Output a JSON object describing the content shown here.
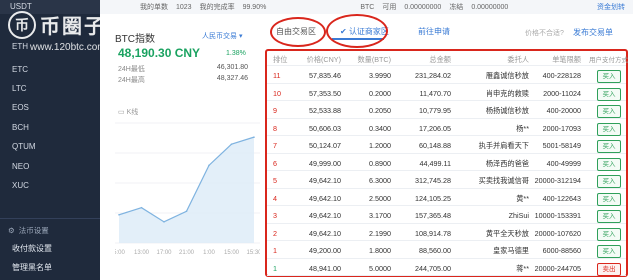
{
  "topbar": {
    "partial_left": "USDT",
    "pending_label": "我的单数",
    "pending_value": "1023",
    "rate_label": "我的完成率",
    "rate_value": "99.90%",
    "coin": "BTC",
    "available_label": "可用",
    "available_value": "0.00000000",
    "frozen_label": "冻结",
    "frozen_value": "0.00000000",
    "right_link": "资金划转"
  },
  "watermark": {
    "brand": "币圈子",
    "url": "www.120btc.com"
  },
  "sidebar": {
    "coins": [
      "ETH",
      "ETC",
      "LTC",
      "EOS",
      "BCH",
      "QTUM",
      "NEO",
      "XUC"
    ],
    "settings_label": "法币设置",
    "links": [
      "收付款设置",
      "管理黑名单"
    ]
  },
  "market": {
    "pair": "BTC指数",
    "market_select": "人民币交易",
    "price": "48,190.30 CNY",
    "change": "1.38%",
    "high_label": "24H最低",
    "high_value": "46,301.80",
    "low_label": "24H最高",
    "low_value": "48,327.46",
    "chart_label": "K线",
    "times": [
      "5:00",
      "13:00",
      "17:00",
      "21:00",
      "1:00",
      "15:00",
      "15:30"
    ]
  },
  "tabs": {
    "free": "自由交易区",
    "cert": "认证商家区",
    "apply": "前往申请",
    "hint": "价格不合适?",
    "post": "发布交易单"
  },
  "table": {
    "headers": {
      "rank": "排位",
      "price": "价格(CNY)",
      "qty": "数量(BTC)",
      "total": "总金额",
      "merchant": "委托人",
      "limit": "单笔限额",
      "action": "用户支付方式"
    },
    "rows": [
      {
        "rank": "11",
        "price": "57,835.46",
        "qty": "3.9990",
        "total": "231,284.02",
        "merchant": "雁鑫诚信秒放",
        "limit": "400-228128",
        "action": "买入"
      },
      {
        "rank": "10",
        "price": "57,353.50",
        "qty": "0.2000",
        "total": "11,470.70",
        "merchant": "肖申克的救赎",
        "limit": "2000-11024",
        "action": "买入"
      },
      {
        "rank": "9",
        "price": "52,533.88",
        "qty": "0.2050",
        "total": "10,779.95",
        "merchant": "杨扬诚信秒放",
        "limit": "400-20000",
        "action": "买入"
      },
      {
        "rank": "8",
        "price": "50,606.03",
        "qty": "0.3400",
        "total": "17,206.05",
        "merchant": "杨**",
        "limit": "2000-17093",
        "action": "买入"
      },
      {
        "rank": "7",
        "price": "50,124.07",
        "qty": "1.2000",
        "total": "60,148.88",
        "merchant": "执手并肩看天下",
        "limit": "5001-58149",
        "action": "买入"
      },
      {
        "rank": "6",
        "price": "49,999.00",
        "qty": "0.8900",
        "total": "44,499.11",
        "merchant": "杨泽西的爸爸",
        "limit": "400-49999",
        "action": "买入"
      },
      {
        "rank": "5",
        "price": "49,642.10",
        "qty": "6.3000",
        "total": "312,745.28",
        "merchant": "买卖找我诚信哥",
        "limit": "20000-312194",
        "action": "买入"
      },
      {
        "rank": "4",
        "price": "49,642.10",
        "qty": "2.5000",
        "total": "124,105.25",
        "merchant": "黄**",
        "limit": "400-122643",
        "action": "买入"
      },
      {
        "rank": "3",
        "price": "49,642.10",
        "qty": "3.1700",
        "total": "157,365.48",
        "merchant": "ZhiSui",
        "limit": "10000-153391",
        "action": "买入"
      },
      {
        "rank": "2",
        "price": "49,642.10",
        "qty": "2.1990",
        "total": "108,914.78",
        "merchant": "黄平全天秒放",
        "limit": "20000-107620",
        "action": "买入"
      },
      {
        "rank": "1",
        "price": "49,200.00",
        "qty": "1.8000",
        "total": "88,560.00",
        "merchant": "皇家马德里",
        "limit": "6000-88560",
        "action": "买入"
      },
      {
        "rank": "1",
        "price": "48,941.00",
        "qty": "5.0000",
        "total": "244,705.00",
        "merchant": "蒋**",
        "limit": "20000-244705",
        "action": "卖出"
      }
    ]
  },
  "chart_data": {
    "type": "line",
    "x": [
      "5:00",
      "13:00",
      "17:00",
      "21:00",
      "1:00",
      "15:00",
      "15:30"
    ],
    "values": [
      48190,
      48200,
      48180,
      48195,
      48260,
      48290,
      48300
    ],
    "title": "",
    "xlabel": "",
    "ylabel": ""
  },
  "colors": {
    "sidebar": "#1f2a3c",
    "accent": "#3a7bd5",
    "up": "#1aa260",
    "down": "#d9261c",
    "highlight": "#d9261c"
  }
}
